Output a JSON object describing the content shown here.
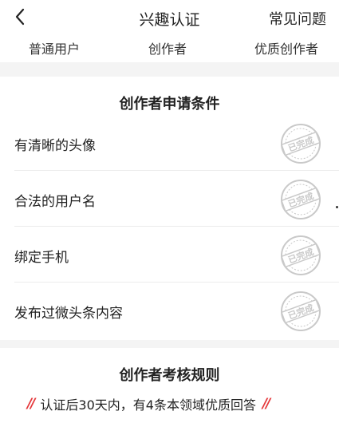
{
  "header": {
    "back_icon": "chevron-left-icon",
    "title": "兴趣认证",
    "faq_label": "常见问题"
  },
  "tabs": [
    {
      "label": "普通用户"
    },
    {
      "label": "创作者"
    },
    {
      "label": "优质创作者"
    }
  ],
  "conditions": {
    "title": "创作者申请条件",
    "items": [
      {
        "label": "有清晰的头像",
        "status": "已完成"
      },
      {
        "label": "合法的用户名",
        "status": "已完成"
      },
      {
        "label": "绑定手机",
        "status": "已完成"
      },
      {
        "label": "发布过微头条内容",
        "status": "已完成"
      }
    ],
    "stamp_color": "#c9c9c9"
  },
  "rules": {
    "title": "创作者考核规则",
    "rule_text": "认证后30天内，有4条本领域优质回答",
    "quote_left": "//",
    "quote_right": "//",
    "accent_color": "#e5383b"
  }
}
